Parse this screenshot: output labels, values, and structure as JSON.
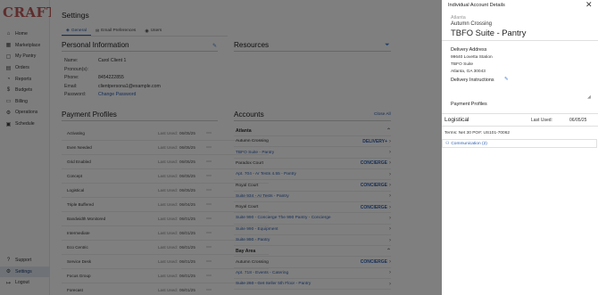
{
  "app": {
    "logo": "CRAFTY"
  },
  "sidebar": {
    "items": [
      {
        "icon": "home-icon",
        "glyph": "⌂",
        "label": "Home"
      },
      {
        "icon": "marketplace-icon",
        "glyph": "▦",
        "label": "Marketplace"
      },
      {
        "icon": "pantry-icon",
        "glyph": "▢",
        "label": "My Pantry"
      },
      {
        "icon": "orders-icon",
        "glyph": "▤",
        "label": "Orders"
      },
      {
        "icon": "reports-icon",
        "glyph": "◔",
        "label": "Reports"
      },
      {
        "icon": "budgets-icon",
        "glyph": "$",
        "label": "Budgets"
      },
      {
        "icon": "billing-icon",
        "glyph": "▭",
        "label": "Billing"
      },
      {
        "icon": "operations-icon",
        "glyph": "⚙",
        "label": "Operations"
      },
      {
        "icon": "schedule-icon",
        "glyph": "▣",
        "label": "Schedule"
      }
    ],
    "bottom": [
      {
        "icon": "support-icon",
        "glyph": "?",
        "label": "Support"
      },
      {
        "icon": "settings-icon",
        "glyph": "⚙",
        "label": "Settings"
      },
      {
        "icon": "logout-icon",
        "glyph": "↦",
        "label": "Logout"
      }
    ]
  },
  "page": {
    "title": "Settings",
    "tabs": [
      {
        "label": "General",
        "glyph": "◈"
      },
      {
        "label": "Email Preferences",
        "glyph": "✉"
      },
      {
        "label": "Users",
        "glyph": "◉"
      }
    ]
  },
  "personal_info": {
    "title": "Personal Information",
    "rows": [
      {
        "label": "Name:",
        "value": "Carol Client 1"
      },
      {
        "label": "Pronoun(s):",
        "value": ""
      },
      {
        "label": "Phone:",
        "value": "8454222855"
      },
      {
        "label": "Email:",
        "value": "clientpersona1@example.com"
      },
      {
        "label": "Password:",
        "value": "Change Password"
      }
    ]
  },
  "payment_profiles": {
    "title": "Payment Profiles",
    "last_used_label": "Last Used:",
    "rows": [
      {
        "name": "Activating",
        "date": "06/05/25"
      },
      {
        "name": "Even Needed",
        "date": "06/05/25"
      },
      {
        "name": "Grid Enabled",
        "date": "06/05/25"
      },
      {
        "name": "Concept",
        "date": "06/05/25"
      },
      {
        "name": "Logistical",
        "date": "06/05/25"
      },
      {
        "name": "Triple Buffered",
        "date": "06/04/25"
      },
      {
        "name": "Bandwidth Monitored",
        "date": "06/01/25"
      },
      {
        "name": "Intermediate",
        "date": "06/01/25"
      },
      {
        "name": "Eco Centric",
        "date": "06/01/25"
      },
      {
        "name": "Service Desk",
        "date": "06/01/25"
      },
      {
        "name": "Focus Group",
        "date": "06/01/25"
      },
      {
        "name": "Forecast",
        "date": "06/01/25"
      }
    ]
  },
  "resources": {
    "title": "Resources"
  },
  "accounts": {
    "title": "Accounts",
    "close_all": "Close All",
    "rows": [
      {
        "kind": "group",
        "name": "Atlanta",
        "tag": "",
        "chev": "⌃"
      },
      {
        "kind": "item",
        "name": "Autumn Crossing",
        "tag": "DELIVERY+",
        "chev": "›"
      },
      {
        "kind": "sub",
        "name": "TBFO Suite - Pantry",
        "tag": "",
        "chev": "›"
      },
      {
        "kind": "item",
        "name": "Paradox Court",
        "tag": "CONCIERGE",
        "chev": "›"
      },
      {
        "kind": "sub",
        "name": "Apt. 704 - Ar Tests 4.55 - Pantry",
        "tag": "",
        "chev": "›"
      },
      {
        "kind": "item",
        "name": "Royal Court",
        "tag": "CONCIERGE",
        "chev": "›"
      },
      {
        "kind": "sub",
        "name": "Suite 934 - Ar Tests - Pantry",
        "tag": "",
        "chev": "›"
      },
      {
        "kind": "item",
        "name": "Royal Court",
        "tag": "CONCIERGE",
        "chev": "›"
      },
      {
        "kind": "sub",
        "name": "Suite 990 - Concierge The 990 Pantry - Concierge",
        "tag": "",
        "chev": "›"
      },
      {
        "kind": "sub",
        "name": "Suite 990 - Equipment",
        "tag": "",
        "chev": "›"
      },
      {
        "kind": "sub",
        "name": "Suite 990 - Pantry",
        "tag": "",
        "chev": "›"
      },
      {
        "kind": "group",
        "name": "Bay Area",
        "tag": "",
        "chev": "⌃"
      },
      {
        "kind": "item",
        "name": "Autumn Crossing",
        "tag": "CONCIERGE",
        "chev": "›"
      },
      {
        "kind": "sub",
        "name": "Apt. 718 - Events - Catering",
        "tag": "",
        "chev": "›"
      },
      {
        "kind": "sub",
        "name": "Suite 260 - Get Seller 5th Floor - Pantry",
        "tag": "",
        "chev": "›"
      }
    ]
  },
  "panel": {
    "title": "Individual Account Details",
    "city": "Atlanta",
    "account": "Autumn Crossing",
    "name": "TBFO Suite - Pantry",
    "delivery_address_label": "Delivery Address",
    "address_lines": [
      "99640 Lovetta Station",
      "TBFO Suite",
      "Atlanta, GA 30043"
    ],
    "delivery_instructions_label": "Delivery Instructions",
    "payment_profiles_label": "Payment Profiles",
    "profile_name": "Logistical",
    "last_used_label": "Last Used:",
    "last_used_date": "06/05/25",
    "terms": "Terms:  Net 30    PO#:  US101-70062",
    "communication": "Communication (2)"
  }
}
